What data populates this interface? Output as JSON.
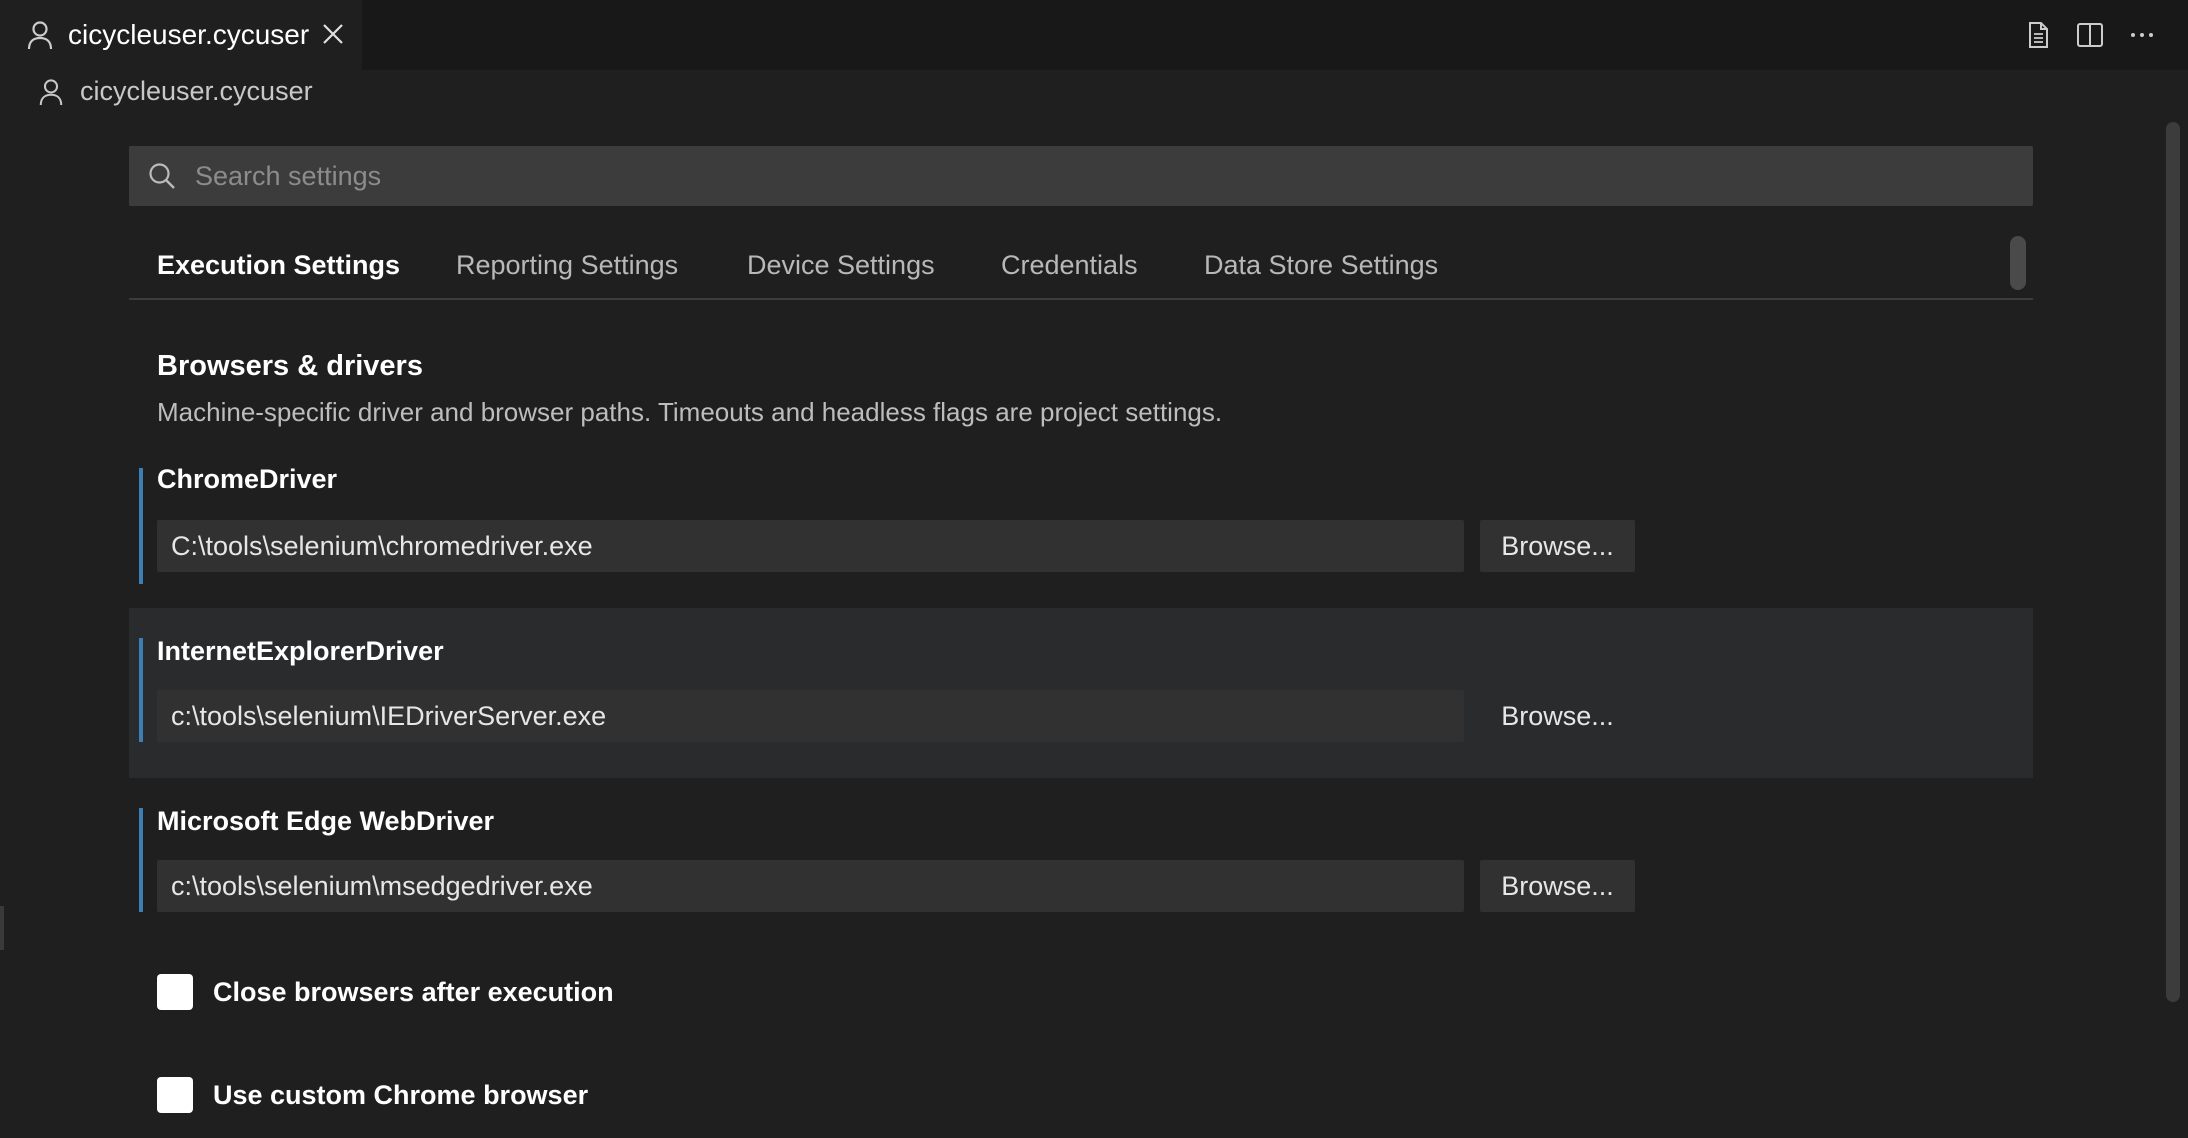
{
  "editor_tab": {
    "title": "cicycleuser.cycuser"
  },
  "breadcrumb": {
    "label": "cicycleuser.cycuser"
  },
  "search": {
    "placeholder": "Search settings"
  },
  "settings_tabs": [
    {
      "label": "Execution Settings",
      "active": true
    },
    {
      "label": "Reporting Settings",
      "active": false
    },
    {
      "label": "Device Settings",
      "active": false
    },
    {
      "label": "Credentials",
      "active": false
    },
    {
      "label": "Data Store Settings",
      "active": false
    }
  ],
  "section": {
    "title": "Browsers & drivers",
    "description": "Machine-specific driver and browser paths. Timeouts and headless flags are project settings."
  },
  "settings": [
    {
      "label": "ChromeDriver",
      "value": "C:\\tools\\selenium\\chromedriver.exe",
      "button": "Browse..."
    },
    {
      "label": "InternetExplorerDriver",
      "value": "c:\\tools\\selenium\\IEDriverServer.exe",
      "button": "Browse..."
    },
    {
      "label": "Microsoft Edge WebDriver",
      "value": "c:\\tools\\selenium\\msedgedriver.exe",
      "button": "Browse..."
    }
  ],
  "checkboxes": [
    {
      "label": "Close browsers after execution",
      "checked": false
    },
    {
      "label": "Use custom Chrome browser",
      "checked": false
    }
  ],
  "colors": {
    "accent_bar": "#3b7fb5",
    "background": "#1f1f1f",
    "input_bg": "#313131"
  }
}
